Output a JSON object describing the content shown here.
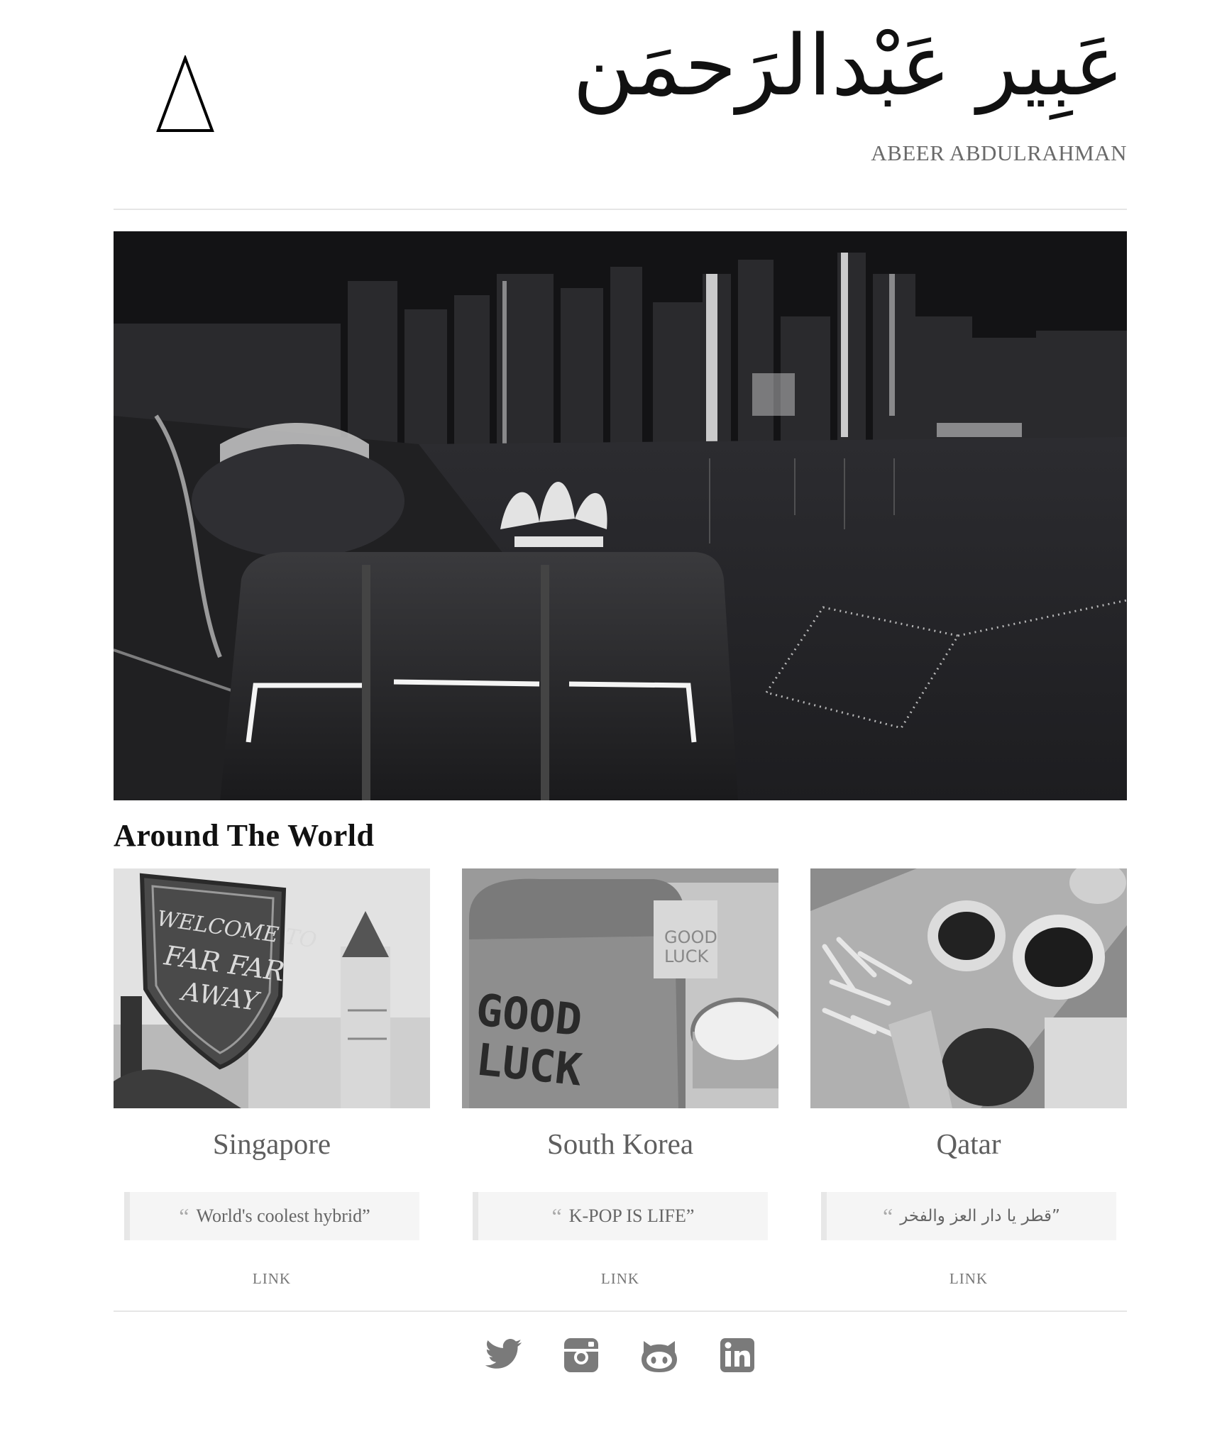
{
  "header": {
    "arabic_name": "عَبِير عَبْدالرَحمَن",
    "latin_name": "ABEER ABDULRAHMAN",
    "logo_icon": "triangle-icon"
  },
  "hero": {
    "image": "night-city-skyline-photo"
  },
  "section": {
    "title": "Around The World"
  },
  "cards": [
    {
      "title": "Singapore",
      "quote_open": "“",
      "quote": "World's coolest hybrid”",
      "link": "LINK",
      "image": "far-far-away-sign-photo"
    },
    {
      "title": "South Korea",
      "quote_open": "“",
      "quote": "K-POP IS LIFE”",
      "link": "LINK",
      "image": "good-luck-toast-photo"
    },
    {
      "title": "Qatar",
      "quote_open": "“",
      "quote": "قطر يا دار العز والفخر”",
      "link": "LINK",
      "image": "fries-and-drinks-photo"
    }
  ],
  "social": [
    "twitter-icon",
    "instagram-icon",
    "github-icon",
    "linkedin-icon"
  ],
  "colors": {
    "text": "#555555",
    "divider": "#e6e6e6",
    "quote_bg": "#f5f5f5",
    "icon": "#777777"
  }
}
